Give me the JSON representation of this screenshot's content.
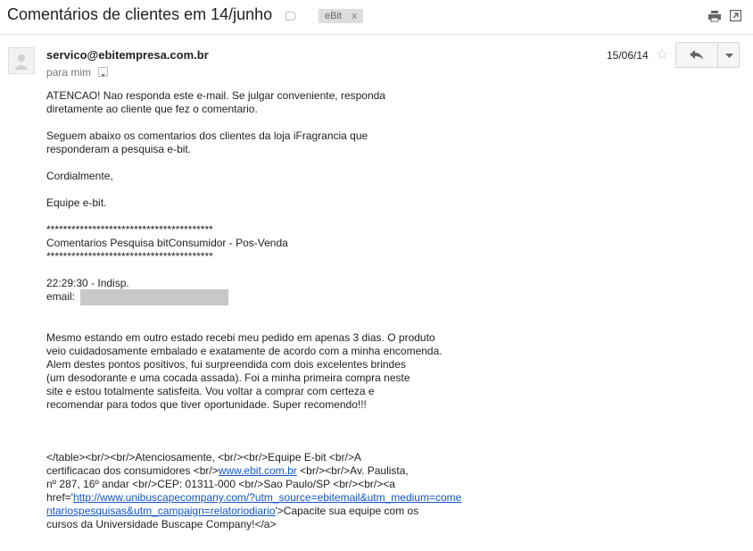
{
  "header": {
    "subject": "Comentários de clientes em 14/junho",
    "label": "eBit",
    "label_remove": "x"
  },
  "icons": [
    "label-tag-icon",
    "print-icon",
    "new-window-icon",
    "avatar-icon",
    "star-icon",
    "reply-icon",
    "chevron-down-icon"
  ],
  "message": {
    "sender": "servico@ebitempresa.com.br",
    "recipient": "para mim",
    "date": "15/06/14",
    "body": [
      "ATENCAO! Nao responda este e-mail. Se julgar conveniente, responda",
      "diretamente ao cliente que fez o comentario.",
      "Seguem abaixo os comentarios dos clientes da loja iFragrancia que",
      "responderam a pesquisa e-bit.",
      "Cordialmente,",
      "Equipe e-bit.",
      "****************************************",
      "Comentarios Pesquisa bitConsumidor - Pos-Venda",
      "****************************************",
      "22:29:30 - Indisp.",
      "email:",
      "Mesmo estando em outro estado recebi meu pedido em apenas 3 dias. O produto",
      "veio cuidadosamente embalado e exatamente de acordo com a minha encomenda.",
      "Alem destes pontos positivos, fui surpreendida com dois excelentes brindes",
      "(um desodorante e uma cocada assada). Foi a minha primeira compra neste",
      "site e estou totalmente satisfeita. Vou voltar a comprar com certeza e",
      "recomendar para todos que tiver oportunidade. Super recomendo!!!",
      "</table><br/><br/>Atenciosamente, <br/><br/>Equipe E-bit <br/>A",
      "certificacao dos consumidores <br/>",
      " <br/><br/>Av. Paulista,",
      "nº 287, 16º andar <br/>CEP: 01311-000 <br/>Sao Paulo/SP <br/><br/><a",
      "href='",
      "'>Capacite sua equipe com os",
      "cursos da Universidade Buscape Company!</a>"
    ],
    "links": {
      "ebit": "www.ebit.com.br",
      "unibuscape_1": "http://www.unibuscapecompany.com/?utm_source=ebitemail&utm_medium=come",
      "unibuscape_2": "ntariospesquisas&utm_campaign=relatoriodiario"
    }
  }
}
